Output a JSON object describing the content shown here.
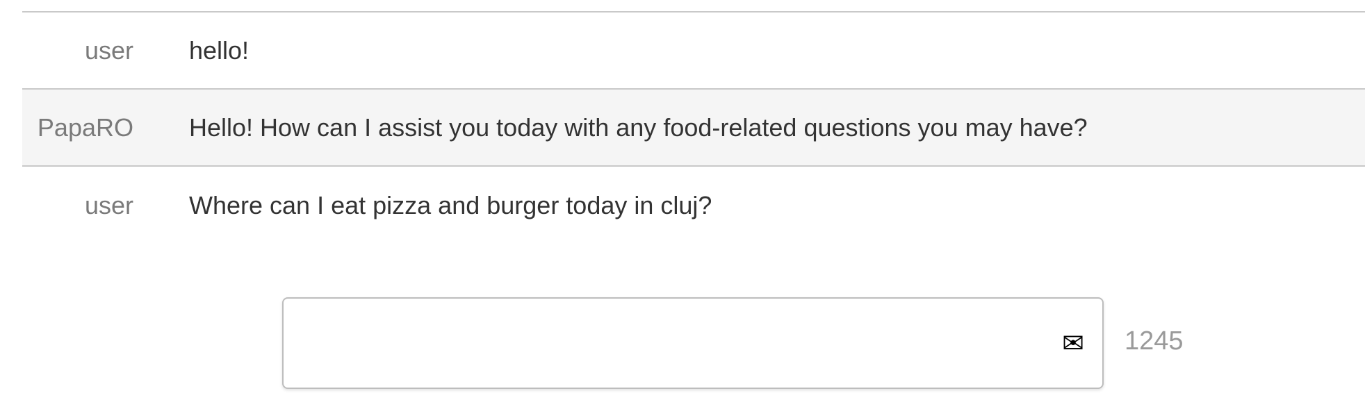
{
  "chat": {
    "messages": [
      {
        "sender": "user",
        "text": "hello!"
      },
      {
        "sender": "PapaRO",
        "text": "Hello! How can I assist you today with any food-related questions you may have?"
      },
      {
        "sender": "user",
        "text": "Where can I eat pizza and burger today in cluj?"
      }
    ]
  },
  "composer": {
    "value": "",
    "placeholder": "",
    "send_icon": "envelope-icon",
    "char_count": "1245"
  },
  "colors": {
    "sender_text": "#7a7a7a",
    "message_text": "#333333",
    "alt_row_background": "#f5f5f5",
    "divider": "#c9c9c9",
    "counter_text": "#9a9a9a"
  }
}
